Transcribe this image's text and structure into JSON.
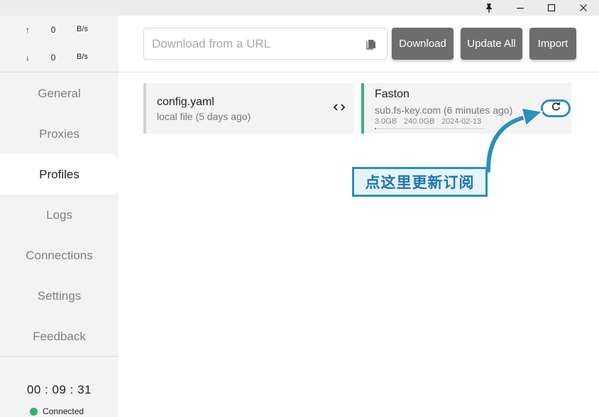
{
  "window": {
    "controls": {
      "pin": "pin-icon",
      "minimize": "minimize-icon",
      "maximize": "maximize-icon",
      "close": "close-icon"
    }
  },
  "traffic": {
    "up_arrow": "↑",
    "up_value": "0",
    "up_unit": "B/s",
    "down_arrow": "↓",
    "down_value": "0",
    "down_unit": "B/s"
  },
  "sidebar": {
    "items": [
      {
        "label": "General"
      },
      {
        "label": "Proxies"
      },
      {
        "label": "Profiles"
      },
      {
        "label": "Logs"
      },
      {
        "label": "Connections"
      },
      {
        "label": "Settings"
      },
      {
        "label": "Feedback"
      }
    ],
    "active": "Profiles",
    "timer": "00 : 09 : 31",
    "status_label": "Connected",
    "status_color": "#2bb56f"
  },
  "toolbar": {
    "url_placeholder": "Download from a URL",
    "download_label": "Download",
    "update_all_label": "Update All",
    "import_label": "Import"
  },
  "profiles": [
    {
      "name": "config.yaml",
      "subtitle": "local file (5 days ago)",
      "accent": "#d0d0d0",
      "action_icon": "code-icon"
    },
    {
      "name": "Faston",
      "subtitle": "sub.fs-key.com (6 minutes ago)",
      "used": "3.0GB",
      "total": "240.0GB",
      "expire": "2024-02-13",
      "accent": "#3fae7b",
      "action_icon": "refresh-icon"
    }
  ],
  "annotation": {
    "text": "点这里更新订阅",
    "color": "#2b8fbf"
  }
}
